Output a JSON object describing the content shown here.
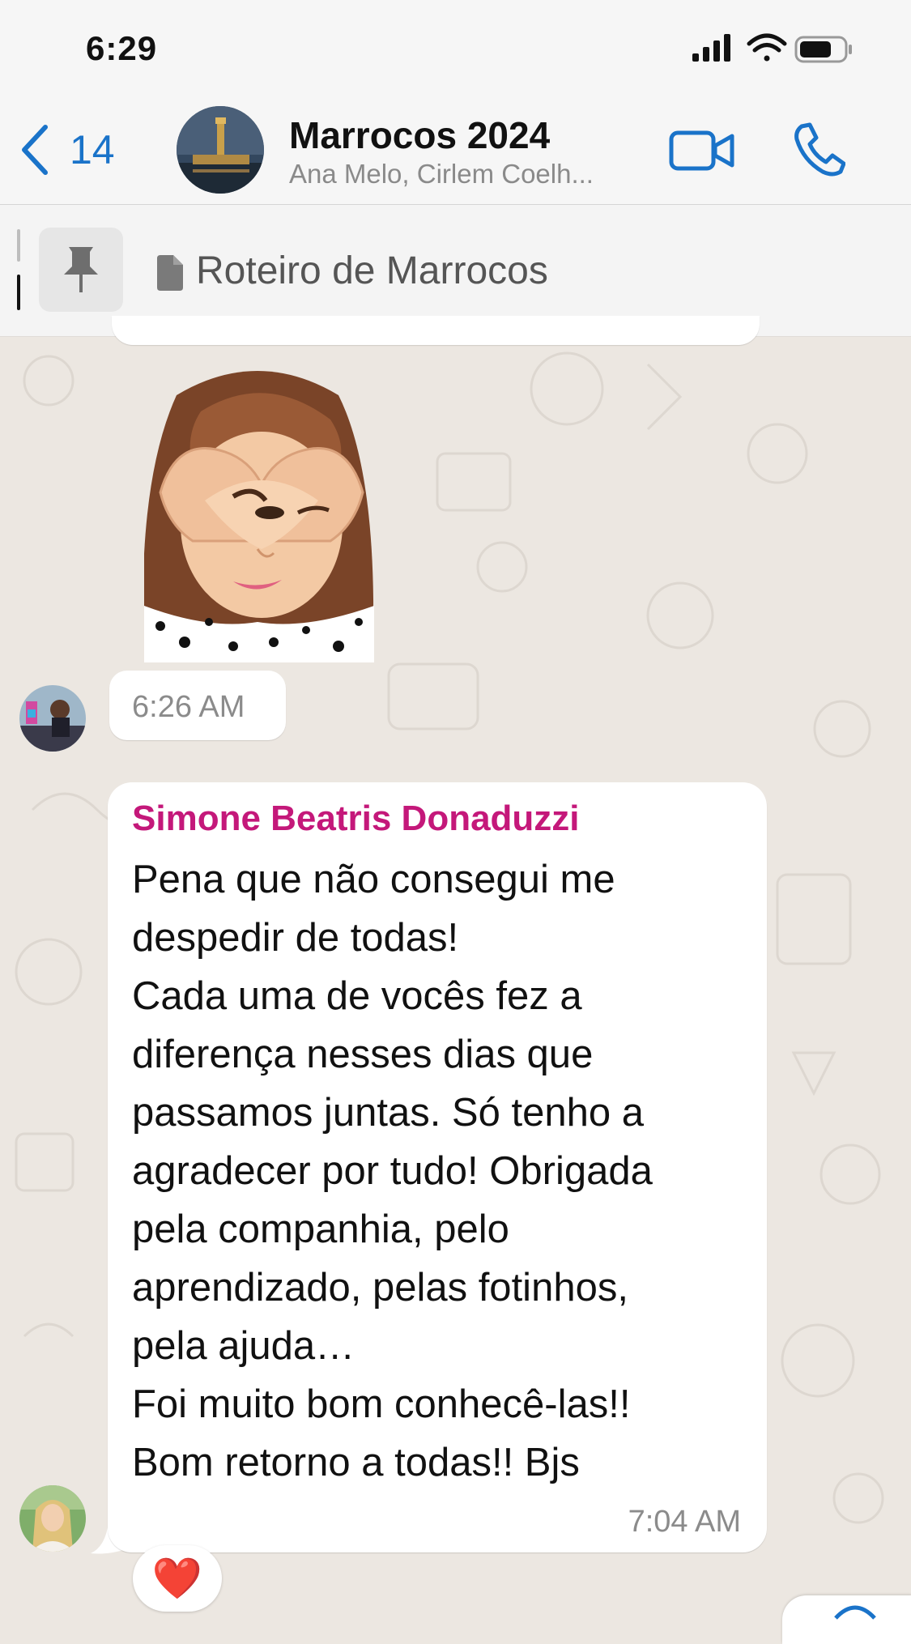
{
  "status_bar": {
    "time": "6:29",
    "icons": [
      "signal-icon",
      "wifi-icon",
      "battery-icon"
    ]
  },
  "header": {
    "back_count": "14",
    "group_name": "Marrocos 2024",
    "members": "Ana Melo, Cirlem Coelh...",
    "icons": [
      "back-chevron-icon",
      "video-call-icon",
      "voice-call-icon"
    ]
  },
  "pinned": {
    "title": "Roteiro de Marrocos",
    "icons": [
      "pin-icon",
      "document-icon"
    ]
  },
  "messages": [
    {
      "type": "sticker",
      "description_icon": "heart-hands-avatar-sticker",
      "time": "6:26 AM"
    },
    {
      "type": "text",
      "sender": "Simone Beatris Donaduzzi",
      "lines": [
        "Pena que não consegui me",
        "despedir de todas!",
        "Cada uma de vocês fez a",
        "diferença nesses dias que",
        "passamos juntas. Só tenho a",
        "agradecer por tudo! Obrigada",
        "pela companhia, pelo",
        "aprendizado, pelas fotinhos,",
        "pela ajuda…",
        "Foi muito bom conhecê-las!!",
        "Bom retorno a todas!! Bjs"
      ],
      "time": "7:04 AM",
      "reaction": "❤️"
    }
  ],
  "colors": {
    "accent": "#1a73c9",
    "sender_name": "#c4187a",
    "chat_background": "#ece7e1",
    "bubble": "#ffffff"
  }
}
